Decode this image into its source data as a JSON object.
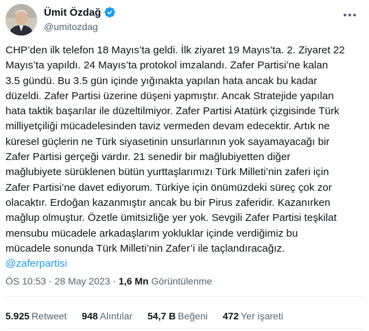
{
  "author": {
    "name": "Ümit Özdağ",
    "handle": "@umitozdag",
    "verified_color": "#1d9bf0"
  },
  "tweet": {
    "lines": [
      "CHP’den ilk telefon 18 Mayıs’ta geldi. İlk ziyaret 19 Mayıs’ta. 2. Ziyaret 22",
      "Mayıs’ta yapıldı. 24 Mayıs’ta protokol imzalandı. Zafer Partisi’ne kalan",
      "3.5 gündü. Bu 3.5 gün içinde yığınakta yapılan hata ancak bu kadar",
      "düzeldi. Zafer Partisi üzerine düşeni yapmıştır. Ancak Stratejide yapılan",
      "hata taktik başarılar ile düzeltilmiyor. Zafer Partisi Atatürk çizgisinde Türk",
      "milliyetçiliği mücadelesinden taviz vermeden devam edecektir. Artık ne",
      "küresel güçlerin ne Türk siyasetinin unsurlarının yok sayamayacağı bir",
      "Zafer Partisi gerçeği vardır. 21 senedir bir mağlubiyetten diğer",
      "mağlubiyete sürüklenen bütün yurttaşlarımızı Türk Milleti’nin zaferi için",
      "Zafer Partisi’ne davet ediyorum. Türkiye için önümüzdeki süreç çok zor",
      "olacaktır. Erdoğan kazanmıştır ancak bu bir Pirus zaferidir. Kazanırken",
      "mağlup olmuştur. Özetle ümitsizliğe yer yok. Sevgili Zafer Partisi teşkilat",
      "mensubu mücadele arkadaşlarım yokluklar içinde verdiğimiz bu",
      "mücadele sonunda Türk Milleti’nin Zafer’i ile taçlandıracağız."
    ],
    "mention": "@zaferpartisi"
  },
  "meta": {
    "time": "ÖS 10:53",
    "separator": " · ",
    "date": "28 May 2023",
    "views_count": "1,6 Mn",
    "views_label": " Görüntülenme"
  },
  "stats": {
    "retweets_count": "5.925",
    "retweets_label": "Retweet",
    "quotes_count": "948",
    "quotes_label": "Alıntılar",
    "likes_count": "54,7 B",
    "likes_label": "Beğeni",
    "bookmarks_count": "472",
    "bookmarks_label": "Yer işareti"
  }
}
